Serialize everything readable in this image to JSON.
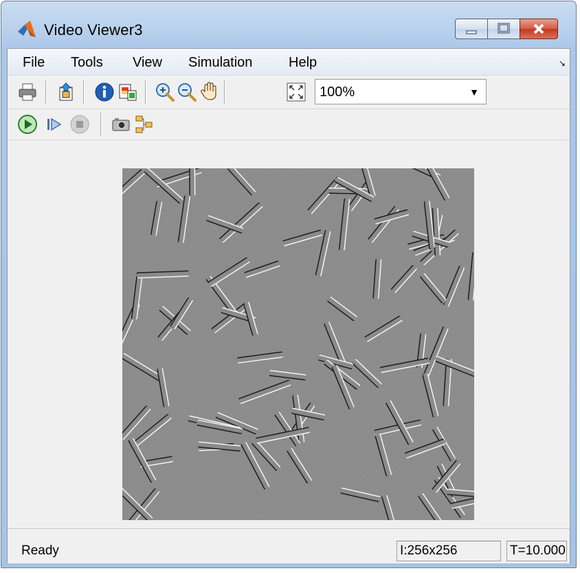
{
  "window": {
    "title": "Video Viewer3"
  },
  "menu": {
    "items": [
      "File",
      "Tools",
      "View",
      "Simulation",
      "Help"
    ]
  },
  "toolbar": {
    "row1_icons": [
      "print-icon",
      "export-icon",
      "info-icon",
      "colormap-icon",
      "zoom-in-icon",
      "zoom-out-icon",
      "pan-hand-icon",
      "fit-to-window-icon"
    ],
    "zoom_value": "100%",
    "row2_icons": [
      "play-icon",
      "step-forward-icon",
      "stop-icon",
      "snapshot-camera-icon",
      "highlight-signal-icon"
    ]
  },
  "status": {
    "text": "Ready",
    "image_size": "I:256x256",
    "time": "T=10.000"
  },
  "colors": {
    "titlebar": "#b9d1ec",
    "close_button": "#c4371e",
    "frame_gray": "#838383"
  }
}
